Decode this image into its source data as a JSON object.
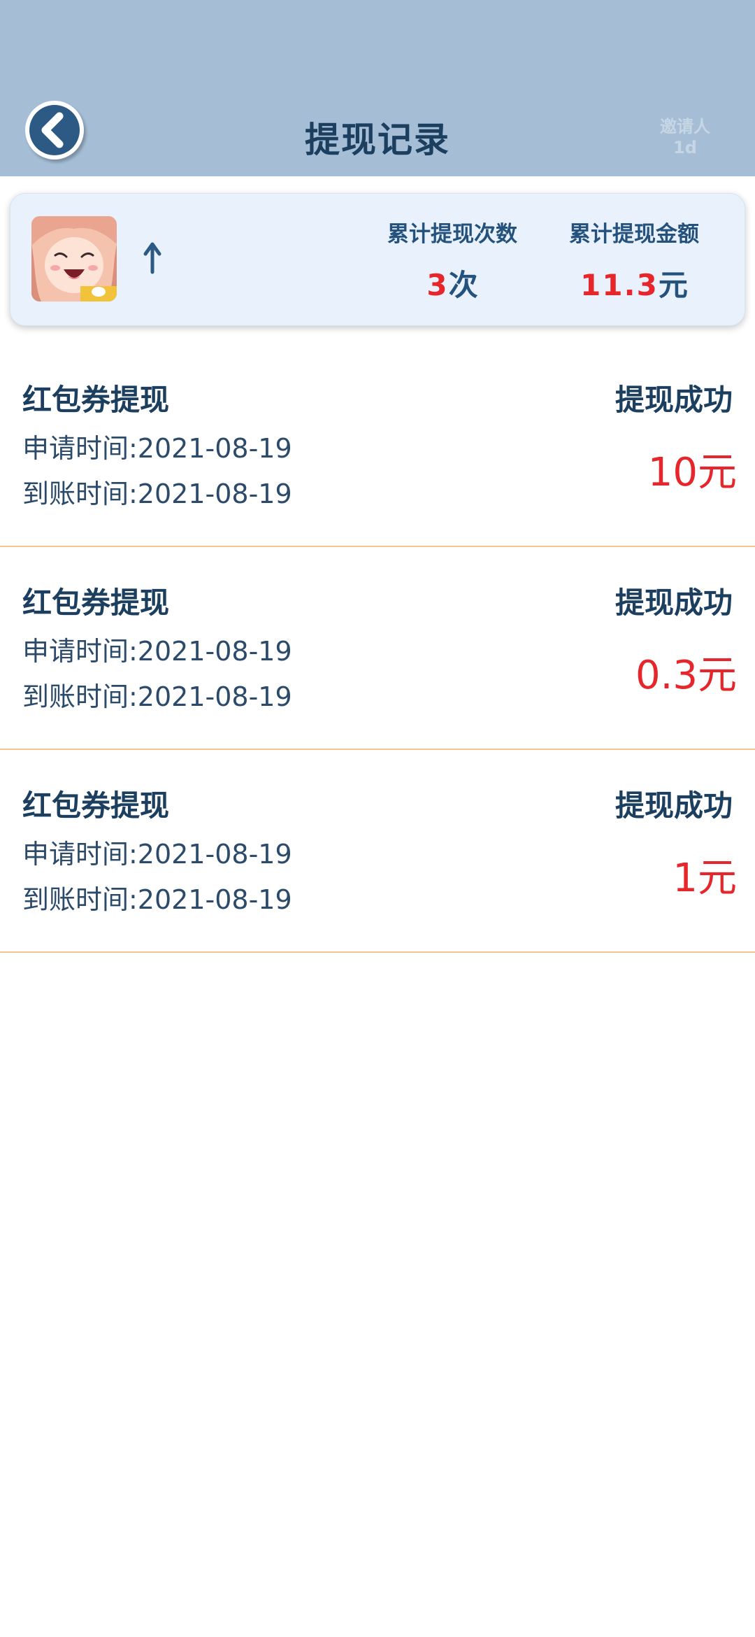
{
  "header": {
    "title": "提现记录",
    "inviter_label": "邀请人",
    "inviter_value": "1d",
    "background_color": "#a5bed6"
  },
  "summary": {
    "count_label": "累计提现次数",
    "count_value": "3",
    "count_unit": "次",
    "amount_label": "累计提现金额",
    "amount_value": "11.3",
    "amount_unit": "元"
  },
  "records": [
    {
      "type": "红包券提现",
      "status": "提现成功",
      "apply_time": "申请时间:2021-08-19",
      "arrive_time": "到账时间:2021-08-19",
      "amount": "10元"
    },
    {
      "type": "红包券提现",
      "status": "提现成功",
      "apply_time": "申请时间:2021-08-19",
      "arrive_time": "到账时间:2021-08-19",
      "amount": "0.3元"
    },
    {
      "type": "红包券提现",
      "status": "提现成功",
      "apply_time": "申请时间:2021-08-19",
      "arrive_time": "到账时间:2021-08-19",
      "amount": "1元"
    }
  ],
  "icons": {
    "back": "back-arrow-icon",
    "avatar": "avatar-image",
    "up": "up-arrow-icon"
  },
  "colors": {
    "accent_red": "#e6262b",
    "text_dark": "#1c3f60",
    "divider": "#f2c58c"
  }
}
